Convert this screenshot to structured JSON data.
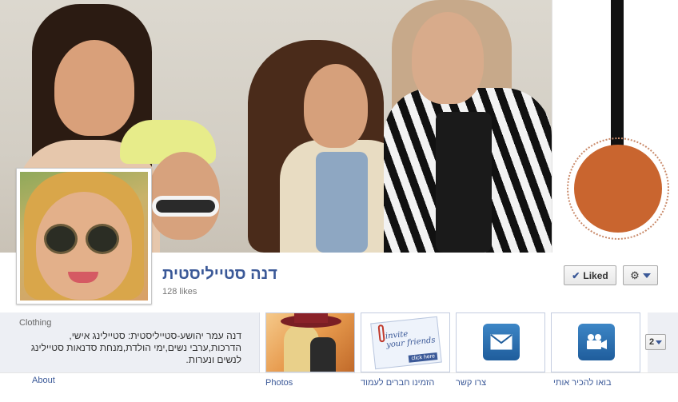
{
  "page": {
    "name": "דנה סטייליסטית",
    "likes": "128 likes"
  },
  "actions": {
    "liked_label": "Liked",
    "more_count": "2"
  },
  "info": {
    "category": "Clothing",
    "about_lines": [
      "דנה עמר יהושע-סטייליסטית: סטיילינג אישי,",
      "הדרכות,ערבי נשים,ימי הולדת,מנחת סדנאות סטיילינג",
      "לנשים ונערות."
    ],
    "about_link": "About"
  },
  "apps": [
    {
      "label": "Photos",
      "icon": "photo-thumbnail"
    },
    {
      "label": "הזמינו חברים לעמוד",
      "icon": "invite-friends-card"
    },
    {
      "label": "צרו קשר",
      "icon": "envelope-icon"
    },
    {
      "label": "בואו להכיר אותי",
      "icon": "video-camera-icon"
    }
  ],
  "invite_card": {
    "line1": "invite",
    "line2": "your friends",
    "button": "click here"
  },
  "colors": {
    "link": "#3b5998",
    "brand_orange": "#c9652f"
  }
}
